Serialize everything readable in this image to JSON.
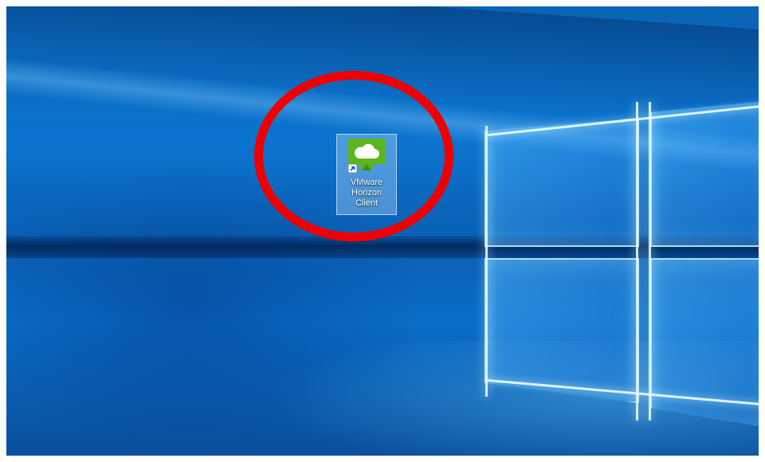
{
  "desktop": {
    "wallpaper": "windows-10-hero-wallpaper",
    "colors": {
      "wallpaper_base": "#0b6fc9",
      "highlight_circle": "#ee0000",
      "icon_selection": "#add8fa",
      "app_icon_green": "#5cb51c"
    },
    "icons": [
      {
        "icon": "vmware-horizon-client-icon",
        "label_lines": [
          "VMware",
          "Horizon",
          "Client"
        ],
        "is_shortcut": true,
        "selected": true
      }
    ]
  },
  "annotation": {
    "shape": "circle",
    "color": "#ee0000",
    "target": "VMware Horizon Client"
  }
}
